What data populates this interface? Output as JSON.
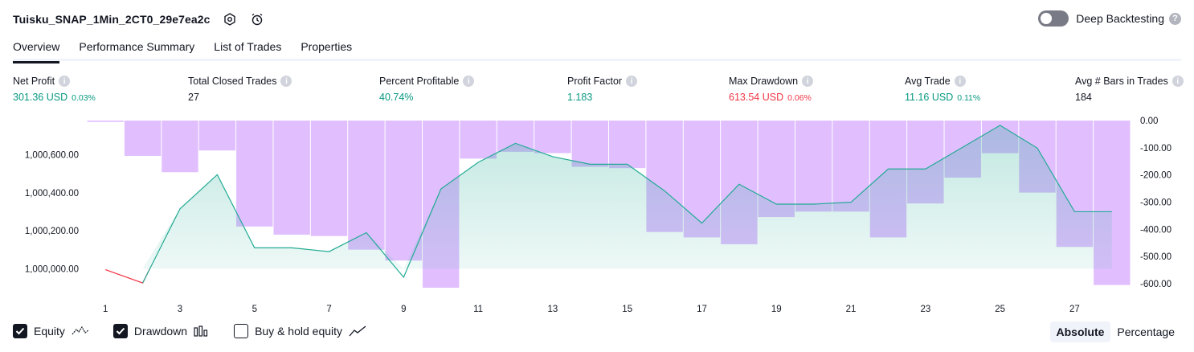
{
  "header": {
    "strategy_name": "Tuisku_SNAP_1Min_2CT0_29e7ea2c",
    "deep_backtesting_label": "Deep Backtesting",
    "deep_backtesting_enabled": false
  },
  "tabs": [
    {
      "label": "Overview",
      "active": true
    },
    {
      "label": "Performance Summary",
      "active": false
    },
    {
      "label": "List of Trades",
      "active": false
    },
    {
      "label": "Properties",
      "active": false
    }
  ],
  "metrics": {
    "net_profit": {
      "label": "Net Profit",
      "value": "301.36 USD",
      "pct": "0.03%"
    },
    "total_closed_trades": {
      "label": "Total Closed Trades",
      "value": "27"
    },
    "percent_profitable": {
      "label": "Percent Profitable",
      "value": "40.74%"
    },
    "profit_factor": {
      "label": "Profit Factor",
      "value": "1.183"
    },
    "max_drawdown": {
      "label": "Max Drawdown",
      "value": "613.54 USD",
      "pct": "0.06%"
    },
    "avg_trade": {
      "label": "Avg Trade",
      "value": "11.16 USD",
      "pct": "0.11%"
    },
    "avg_bars": {
      "label": "Avg # Bars in Trades",
      "value": "184"
    }
  },
  "colors": {
    "equity_line": "#22ab94",
    "equity_negative": "#f23645",
    "drawdown_bar": "#e1bfff",
    "positive_text": "#089981",
    "negative_text": "#f23645"
  },
  "chart_data": {
    "type": "area",
    "x": [
      1,
      2,
      3,
      4,
      5,
      6,
      7,
      8,
      9,
      10,
      11,
      12,
      13,
      14,
      15,
      16,
      17,
      18,
      19,
      20,
      21,
      22,
      23,
      24,
      25,
      26,
      27,
      28
    ],
    "x_ticks": [
      "1",
      "3",
      "5",
      "7",
      "9",
      "11",
      "13",
      "15",
      "17",
      "19",
      "21",
      "23",
      "25",
      "27"
    ],
    "equity_axis": {
      "ticks": [
        "1,000,000.00",
        "1,000,200.00",
        "1,000,400.00",
        "1,000,600.00"
      ],
      "range": [
        999900,
        1000780
      ]
    },
    "drawdown_axis": {
      "ticks": [
        "0.00",
        "-100.00",
        "-200.00",
        "-300.00",
        "-400.00",
        "-500.00",
        "-600.00"
      ],
      "range": [
        -615,
        0
      ]
    },
    "series": [
      {
        "name": "Equity",
        "values": [
          999995,
          999925,
          1000315,
          1000495,
          1000110,
          1000110,
          1000090,
          1000190,
          999955,
          1000420,
          1000560,
          1000660,
          1000590,
          1000550,
          1000550,
          1000410,
          1000240,
          1000445,
          1000340,
          1000340,
          1000350,
          1000525,
          1000525,
          1000640,
          1000755,
          1000635,
          1000300,
          1000300
        ]
      },
      {
        "name": "Drawdown",
        "values": [
          -5,
          -130,
          -190,
          -110,
          -390,
          -420,
          -425,
          -475,
          -515,
          -615,
          -140,
          -115,
          -120,
          -170,
          -175,
          -410,
          -430,
          -455,
          -355,
          -335,
          -335,
          -430,
          -305,
          -210,
          -120,
          -265,
          -465,
          -605
        ]
      }
    ]
  },
  "legend": {
    "equity": {
      "label": "Equity",
      "checked": true
    },
    "drawdown": {
      "label": "Drawdown",
      "checked": true
    },
    "buy_hold": {
      "label": "Buy & hold equity",
      "checked": false
    }
  },
  "mode": {
    "absolute": "Absolute",
    "percentage": "Percentage",
    "active": "absolute"
  }
}
